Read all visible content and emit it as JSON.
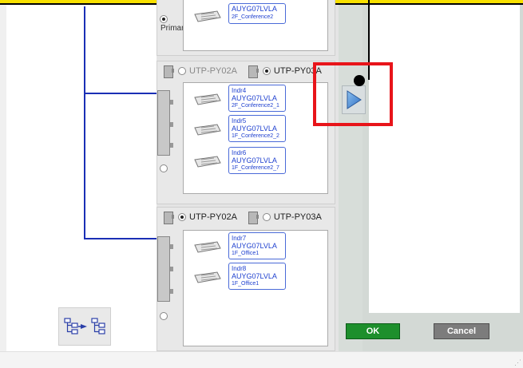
{
  "top_group": {
    "unit_label": "Primary",
    "indoor_units": [
      {
        "model": "AUYG07LVLA",
        "room": "2F_Conference2"
      }
    ]
  },
  "groups": [
    {
      "port_a_label": "UTP-PY02A",
      "port_b_label": "UTP-PY03A",
      "selected_port": "b",
      "indoor_units": [
        {
          "name": "Indr4",
          "model": "AUYG07LVLA",
          "room": "2F_Conference2_1"
        },
        {
          "name": "Indr5",
          "model": "AUYG07LVLA",
          "room": "1F_Conference2_2"
        },
        {
          "name": "Indr6",
          "model": "AUYG07LVLA",
          "room": "1F_Conference2_7"
        }
      ]
    },
    {
      "port_a_label": "UTP-PY02A",
      "port_b_label": "UTP-PY03A",
      "selected_port": "a",
      "indoor_units": [
        {
          "name": "Indr7",
          "model": "AUYG07LVLA",
          "room": "1F_Office1"
        },
        {
          "name": "Indr8",
          "model": "AUYG07LVLA",
          "room": "1F_Office1"
        }
      ]
    }
  ],
  "buttons": {
    "ok_label": "OK",
    "cancel_label": "Cancel"
  },
  "icons": {
    "move_right": "play-right-icon",
    "swap": "swap-tree-icon",
    "air_conditioner": "cassette-ac-icon",
    "unit": "outdoor-unit-icon"
  },
  "colors": {
    "tree_line": "#1a2fb5",
    "tag_text": "#1d3fcf",
    "ok_button": "#1d8f2c",
    "cancel_button": "#7c7c7c",
    "highlight": "#e8141a",
    "play_arrow": "#4a90d9"
  }
}
